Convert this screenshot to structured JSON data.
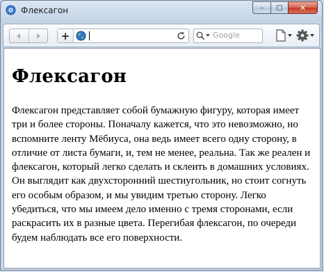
{
  "window": {
    "title": "Флексагон",
    "caption_buttons": {
      "minimize": "–",
      "maximize": "□",
      "close": "✕"
    }
  },
  "toolbar": {
    "add_tab_label": "+",
    "search_placeholder": "Google",
    "icons": {
      "back": "back-arrow-icon",
      "forward": "forward-arrow-icon",
      "globe": "globe-icon",
      "reload": "reload-icon",
      "search": "search-icon",
      "page": "page-menu-icon",
      "settings": "gear-icon"
    }
  },
  "page": {
    "heading": "Флексагон",
    "paragraph": "Флексагон представляет собой бумажную фигуру, которая имеет три и более стороны. Поначалу кажется, что это невозможно, но вспомните ленту Мёбиуса, она ведь имеет всего одну сторону, в отличие от листа бумаги, и, тем не менее, реальна. Так же реален и флексагон, который легко сделать и склеить в домашних условиях. Он выглядит как двухсторонний шестиугольник, но стоит согнуть его особым образом, и мы увидим третью сторону. Легко убедиться, что мы имеем дело именно с тремя сторонами, если раскрасить их в разные цвета. Перегибая флексагон, по очереди будем наблюдать все его поверхности."
  },
  "colors": {
    "title_bar": "#c9d7e8",
    "close_button": "#c2391f",
    "globe": "#2f76c9",
    "page_background": "#ffffff"
  }
}
